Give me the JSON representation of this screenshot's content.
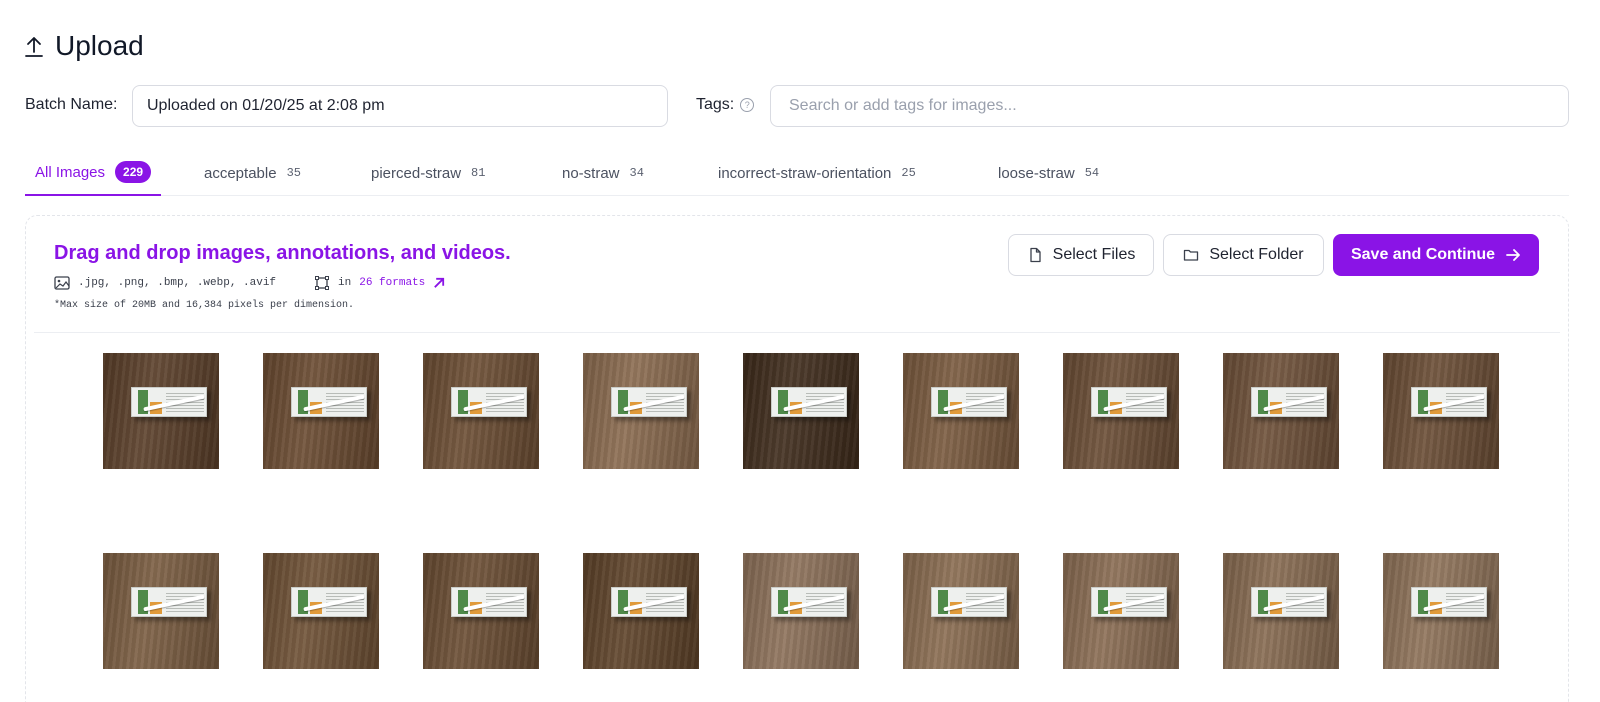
{
  "header": {
    "title": "Upload",
    "icon": "upload-icon"
  },
  "batch": {
    "label": "Batch Name:",
    "value": "Uploaded on 01/20/25 at 2:08 pm"
  },
  "tags": {
    "label": "Tags:",
    "help_icon": "help-circle-icon",
    "placeholder": "Search or add tags for images..."
  },
  "tabs": [
    {
      "label": "All Images",
      "count": "229",
      "active": true
    },
    {
      "label": "acceptable",
      "count": "35"
    },
    {
      "label": "pierced-straw",
      "count": "81"
    },
    {
      "label": "no-straw",
      "count": "34"
    },
    {
      "label": "incorrect-straw-orientation",
      "count": "25"
    },
    {
      "label": "loose-straw",
      "count": "54"
    }
  ],
  "dropzone": {
    "title": "Drag and drop images, annotations, and videos.",
    "image_formats": ".jpg, .png, .bmp, .webp, .avif",
    "annotation_prefix": "in",
    "annotation_link": "26 formats",
    "max_size": "*Max size of 20MB and 16,384 pixels per dimension."
  },
  "actions": {
    "select_files": "Select Files",
    "select_folder": "Select Folder",
    "save_continue": "Save and Continue"
  },
  "colors": {
    "accent": "#8a14e6"
  },
  "thumbnails": [
    {
      "wood": "#5a3e28"
    },
    {
      "wood": "#6a4a30"
    },
    {
      "wood": "#6b4c32"
    },
    {
      "wood": "#8a6a4e"
    },
    {
      "wood": "#3e2a1a"
    },
    {
      "wood": "#7a5a3e"
    },
    {
      "wood": "#6a4c34"
    },
    {
      "wood": "#6e5038"
    },
    {
      "wood": "#6a4c34"
    },
    {
      "wood": "#7a5c40"
    },
    {
      "wood": "#6e5034"
    },
    {
      "wood": "#6a4c32"
    },
    {
      "wood": "#5e4228"
    },
    {
      "wood": "#8c7058"
    },
    {
      "wood": "#8a6c50"
    },
    {
      "wood": "#8a6c52"
    },
    {
      "wood": "#876a50"
    },
    {
      "wood": "#8e7258"
    }
  ]
}
